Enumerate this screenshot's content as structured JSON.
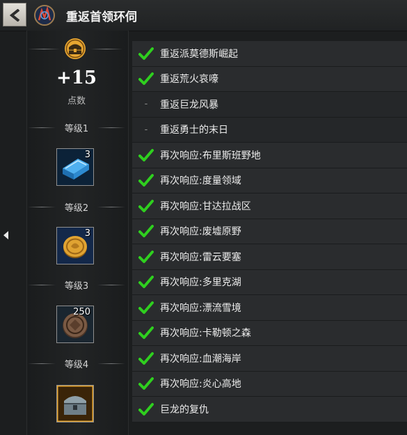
{
  "window": {
    "title": "重返首领环伺"
  },
  "icons": {
    "back": "back-arrow-icon",
    "title": "return-achievement-emblem-icon",
    "header": "achievement-chest-icon",
    "collapse": "collapse-left-arrow-icon"
  },
  "summary": {
    "points": "+15",
    "points_label": "点数"
  },
  "levels": [
    {
      "label": "等级1",
      "reward_icon": "blue-ingot-icon",
      "count": "3"
    },
    {
      "label": "等级2",
      "reward_icon": "gold-coin-icon",
      "count": "3"
    },
    {
      "label": "等级3",
      "reward_icon": "bronze-token-icon",
      "count": "250"
    },
    {
      "label": "等级4",
      "reward_icon": "treasure-chest-icon",
      "count": ""
    }
  ],
  "objectives": [
    {
      "label": "重返派莫德斯崛起",
      "done": true
    },
    {
      "label": "重返荒火哀嚎",
      "done": true
    },
    {
      "label": "重返巨龙风暴",
      "done": false
    },
    {
      "label": "重返勇士的末日",
      "done": false
    },
    {
      "label": "再次响应:布里斯班野地",
      "done": true
    },
    {
      "label": "再次响应:度量领域",
      "done": true
    },
    {
      "label": "再次响应:甘达拉战区",
      "done": true
    },
    {
      "label": "再次响应:废墟原野",
      "done": true
    },
    {
      "label": "再次响应:雷云要塞",
      "done": true
    },
    {
      "label": "再次响应:多里克湖",
      "done": true
    },
    {
      "label": "再次响应:漂流雪境",
      "done": true
    },
    {
      "label": "再次响应:卡勒顿之森",
      "done": true
    },
    {
      "label": "再次响应:血潮海岸",
      "done": true
    },
    {
      "label": "再次响应:炎心高地",
      "done": true
    },
    {
      "label": "巨龙的复仇",
      "done": true
    }
  ],
  "colors": {
    "check": "#2fcf1f",
    "accent": "#e7a631"
  }
}
